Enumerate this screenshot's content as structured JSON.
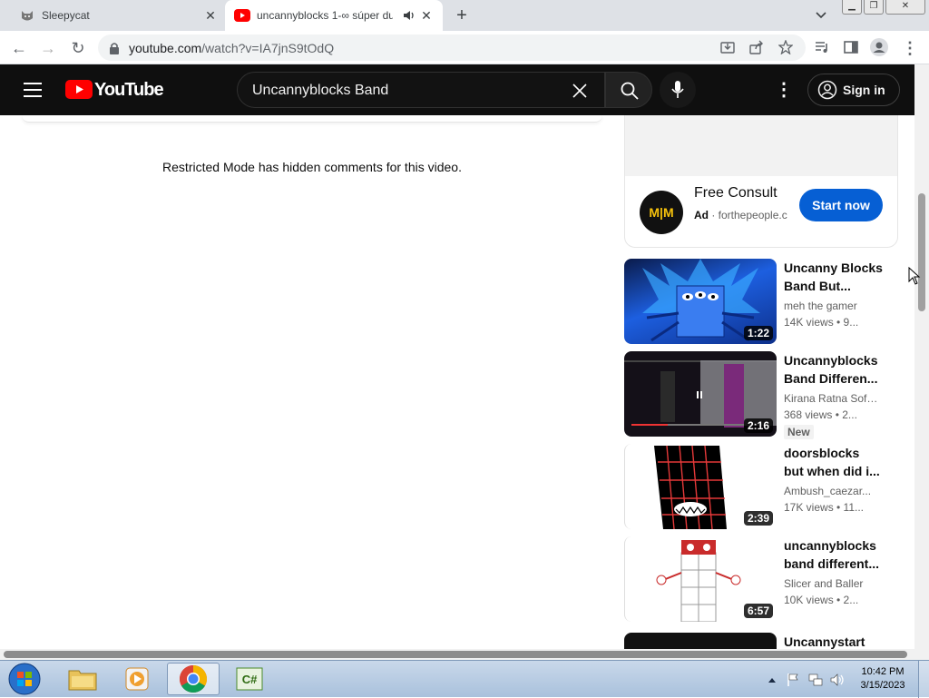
{
  "browser": {
    "tabs": [
      {
        "title": "Sleepycat",
        "icon": "cat-icon"
      },
      {
        "title": "uncannyblocks 1-∞ súper du",
        "icon": "youtube-icon",
        "audio": true
      }
    ],
    "url_host": "youtube.com",
    "url_path": "/watch?v=IA7jnS9tOdQ"
  },
  "youtube": {
    "logo_text": "YouTube",
    "search_value": "Uncannyblocks Band",
    "signin_label": "Sign in"
  },
  "comments": {
    "restricted_message": "Restricted Mode has hidden comments for this video."
  },
  "ad": {
    "logo_text": "M|M",
    "title": "Free Consult",
    "label": "Ad",
    "domain": "forthepeople.c",
    "cta": "Start now",
    "brand_color": "#065fd4"
  },
  "recommendations": [
    {
      "title_line1": "Uncanny Blocks",
      "title_line2": "Band But...",
      "channel": "meh the gamer",
      "meta": "14K views • 9...",
      "duration": "1:22"
    },
    {
      "title_line1": "Uncannyblocks",
      "title_line2": "Band Differen...",
      "channel": "Kirana Ratna Sofi...",
      "meta": "368 views • 2...",
      "duration": "2:16",
      "badge": "New"
    },
    {
      "title_line1": "doorsblocks",
      "title_line2": "but when did i...",
      "channel": "Ambush_caezar...",
      "meta": "17K views • 11...",
      "duration": "2:39"
    },
    {
      "title_line1": "uncannyblocks",
      "title_line2": "band different...",
      "channel": "Slicer and Baller",
      "meta": "10K views • 2...",
      "duration": "6:57"
    },
    {
      "title_line1": "Uncannystart",
      "title_line2": "",
      "channel": "",
      "meta": "",
      "duration": ""
    }
  ],
  "taskbar": {
    "time": "10:42 PM",
    "date": "3/15/2023"
  }
}
